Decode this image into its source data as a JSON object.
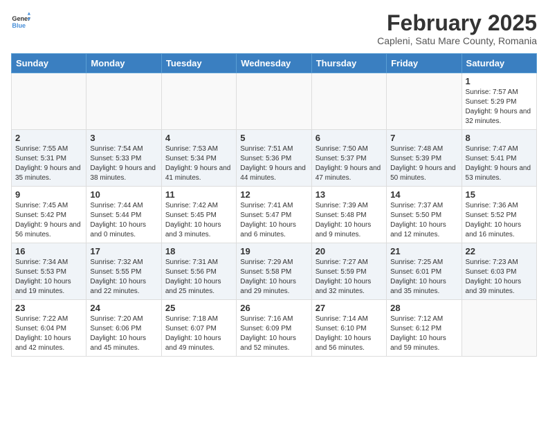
{
  "header": {
    "logo_general": "General",
    "logo_blue": "Blue",
    "month_year": "February 2025",
    "location": "Capleni, Satu Mare County, Romania"
  },
  "weekdays": [
    "Sunday",
    "Monday",
    "Tuesday",
    "Wednesday",
    "Thursday",
    "Friday",
    "Saturday"
  ],
  "weeks": [
    [
      {
        "day": "",
        "info": ""
      },
      {
        "day": "",
        "info": ""
      },
      {
        "day": "",
        "info": ""
      },
      {
        "day": "",
        "info": ""
      },
      {
        "day": "",
        "info": ""
      },
      {
        "day": "",
        "info": ""
      },
      {
        "day": "1",
        "info": "Sunrise: 7:57 AM\nSunset: 5:29 PM\nDaylight: 9 hours and 32 minutes."
      }
    ],
    [
      {
        "day": "2",
        "info": "Sunrise: 7:55 AM\nSunset: 5:31 PM\nDaylight: 9 hours and 35 minutes."
      },
      {
        "day": "3",
        "info": "Sunrise: 7:54 AM\nSunset: 5:33 PM\nDaylight: 9 hours and 38 minutes."
      },
      {
        "day": "4",
        "info": "Sunrise: 7:53 AM\nSunset: 5:34 PM\nDaylight: 9 hours and 41 minutes."
      },
      {
        "day": "5",
        "info": "Sunrise: 7:51 AM\nSunset: 5:36 PM\nDaylight: 9 hours and 44 minutes."
      },
      {
        "day": "6",
        "info": "Sunrise: 7:50 AM\nSunset: 5:37 PM\nDaylight: 9 hours and 47 minutes."
      },
      {
        "day": "7",
        "info": "Sunrise: 7:48 AM\nSunset: 5:39 PM\nDaylight: 9 hours and 50 minutes."
      },
      {
        "day": "8",
        "info": "Sunrise: 7:47 AM\nSunset: 5:41 PM\nDaylight: 9 hours and 53 minutes."
      }
    ],
    [
      {
        "day": "9",
        "info": "Sunrise: 7:45 AM\nSunset: 5:42 PM\nDaylight: 9 hours and 56 minutes."
      },
      {
        "day": "10",
        "info": "Sunrise: 7:44 AM\nSunset: 5:44 PM\nDaylight: 10 hours and 0 minutes."
      },
      {
        "day": "11",
        "info": "Sunrise: 7:42 AM\nSunset: 5:45 PM\nDaylight: 10 hours and 3 minutes."
      },
      {
        "day": "12",
        "info": "Sunrise: 7:41 AM\nSunset: 5:47 PM\nDaylight: 10 hours and 6 minutes."
      },
      {
        "day": "13",
        "info": "Sunrise: 7:39 AM\nSunset: 5:48 PM\nDaylight: 10 hours and 9 minutes."
      },
      {
        "day": "14",
        "info": "Sunrise: 7:37 AM\nSunset: 5:50 PM\nDaylight: 10 hours and 12 minutes."
      },
      {
        "day": "15",
        "info": "Sunrise: 7:36 AM\nSunset: 5:52 PM\nDaylight: 10 hours and 16 minutes."
      }
    ],
    [
      {
        "day": "16",
        "info": "Sunrise: 7:34 AM\nSunset: 5:53 PM\nDaylight: 10 hours and 19 minutes."
      },
      {
        "day": "17",
        "info": "Sunrise: 7:32 AM\nSunset: 5:55 PM\nDaylight: 10 hours and 22 minutes."
      },
      {
        "day": "18",
        "info": "Sunrise: 7:31 AM\nSunset: 5:56 PM\nDaylight: 10 hours and 25 minutes."
      },
      {
        "day": "19",
        "info": "Sunrise: 7:29 AM\nSunset: 5:58 PM\nDaylight: 10 hours and 29 minutes."
      },
      {
        "day": "20",
        "info": "Sunrise: 7:27 AM\nSunset: 5:59 PM\nDaylight: 10 hours and 32 minutes."
      },
      {
        "day": "21",
        "info": "Sunrise: 7:25 AM\nSunset: 6:01 PM\nDaylight: 10 hours and 35 minutes."
      },
      {
        "day": "22",
        "info": "Sunrise: 7:23 AM\nSunset: 6:03 PM\nDaylight: 10 hours and 39 minutes."
      }
    ],
    [
      {
        "day": "23",
        "info": "Sunrise: 7:22 AM\nSunset: 6:04 PM\nDaylight: 10 hours and 42 minutes."
      },
      {
        "day": "24",
        "info": "Sunrise: 7:20 AM\nSunset: 6:06 PM\nDaylight: 10 hours and 45 minutes."
      },
      {
        "day": "25",
        "info": "Sunrise: 7:18 AM\nSunset: 6:07 PM\nDaylight: 10 hours and 49 minutes."
      },
      {
        "day": "26",
        "info": "Sunrise: 7:16 AM\nSunset: 6:09 PM\nDaylight: 10 hours and 52 minutes."
      },
      {
        "day": "27",
        "info": "Sunrise: 7:14 AM\nSunset: 6:10 PM\nDaylight: 10 hours and 56 minutes."
      },
      {
        "day": "28",
        "info": "Sunrise: 7:12 AM\nSunset: 6:12 PM\nDaylight: 10 hours and 59 minutes."
      },
      {
        "day": "",
        "info": ""
      }
    ]
  ]
}
